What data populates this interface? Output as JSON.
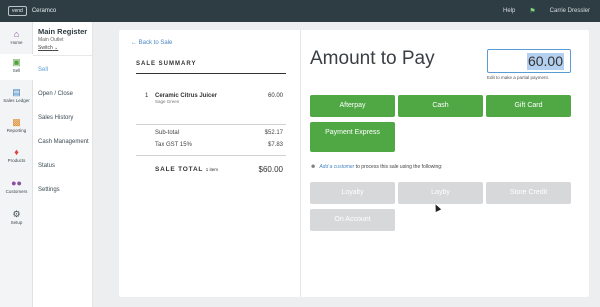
{
  "topbar": {
    "logo": "vend",
    "store_name": "Ceramco",
    "help": "Help",
    "user": "Carrie Dressler",
    "notification_icon": "bell-icon"
  },
  "sidebar": {
    "items": [
      {
        "label": "Home",
        "icon": "home-icon"
      },
      {
        "label": "Sell",
        "icon": "register-icon"
      },
      {
        "label": "Sales Ledger",
        "icon": "ledger-icon"
      },
      {
        "label": "Reporting",
        "icon": "chart-icon"
      },
      {
        "label": "Products",
        "icon": "tag-icon"
      },
      {
        "label": "Customers",
        "icon": "people-icon"
      },
      {
        "label": "Setup",
        "icon": "gear-icon"
      }
    ]
  },
  "subnav": {
    "register_name": "Main Register",
    "outlet": "Main Outlet",
    "switch": "Switch",
    "items": [
      "Sell",
      "Open / Close",
      "Sales History",
      "Cash Management",
      "Status",
      "Settings"
    ]
  },
  "sale": {
    "back": "Back to Sale",
    "summary_title": "SALE SUMMARY",
    "line_items": [
      {
        "qty": "1",
        "name": "Ceramic Citrus Juicer",
        "variant": "Sage Green",
        "price": "60.00"
      }
    ],
    "subtotal_label": "Sub-total",
    "subtotal_value": "$52.17",
    "tax_label": "Tax GST 15%",
    "tax_value": "$7.83",
    "total_label": "SALE TOTAL",
    "total_count": "1 item",
    "total_value": "$60.00"
  },
  "payment": {
    "title": "Amount to Pay",
    "amount": "60.00",
    "hint": "Edit to make a partial payment.",
    "methods": [
      "Afterpay",
      "Cash",
      "Gift Card",
      "Payment Express"
    ],
    "customer_link": "Add a customer",
    "customer_text": "to process this sale using the following:",
    "customer_methods": [
      "Loyalty",
      "Layby",
      "Store Credit",
      "On Account"
    ]
  },
  "colors": {
    "green": "#50a845",
    "topbar": "#2e3c43",
    "link": "#4a86c5",
    "disabled": "#d6d8d9"
  }
}
